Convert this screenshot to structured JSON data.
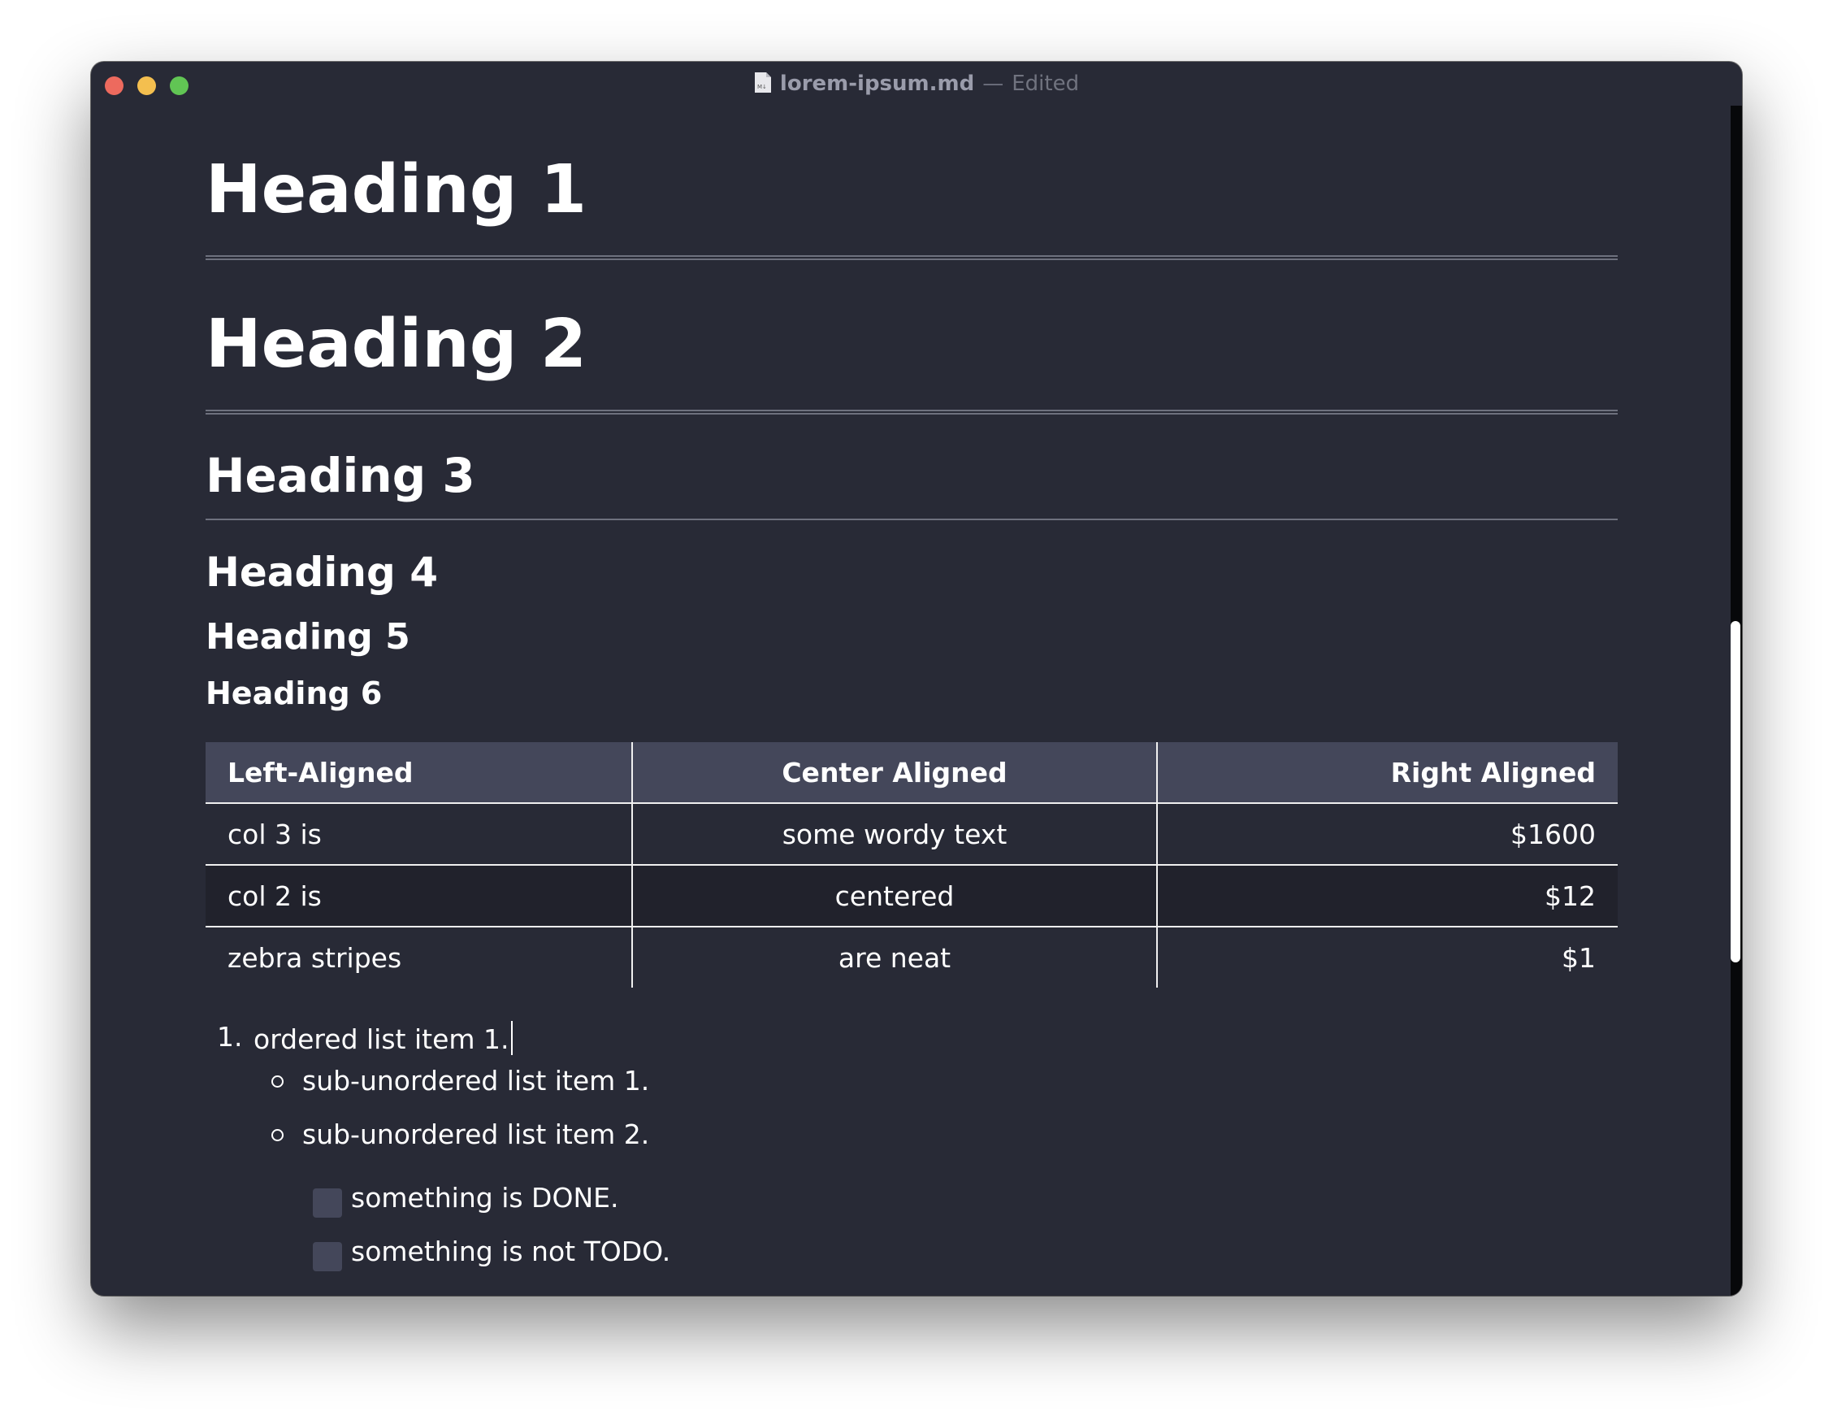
{
  "window": {
    "filename": "lorem-ipsum.md",
    "separator": "—",
    "status": "Edited"
  },
  "headings": {
    "h1": "Heading 1",
    "h2": "Heading 2",
    "h3": "Heading 3",
    "h4": "Heading 4",
    "h5": "Heading 5",
    "h6": "Heading 6"
  },
  "table": {
    "headers": [
      "Left-Aligned",
      "Center Aligned",
      "Right Aligned"
    ],
    "rows": [
      [
        "col 3 is",
        "some wordy text",
        "$1600"
      ],
      [
        "col 2 is",
        "centered",
        "$12"
      ],
      [
        "zebra stripes",
        "are neat",
        "$1"
      ]
    ]
  },
  "list": {
    "ordered_marker": "1.",
    "ordered_item": "ordered list item 1.",
    "sub_items": [
      "sub-unordered list item 1.",
      "sub-unordered list item 2."
    ],
    "tasks": [
      "something is DONE.",
      "something is not TODO."
    ]
  },
  "colors": {
    "background": "#282a36",
    "header_row": "#44475a",
    "zebra_row": "#21222c"
  },
  "icons": [
    "markdown-file-icon"
  ]
}
